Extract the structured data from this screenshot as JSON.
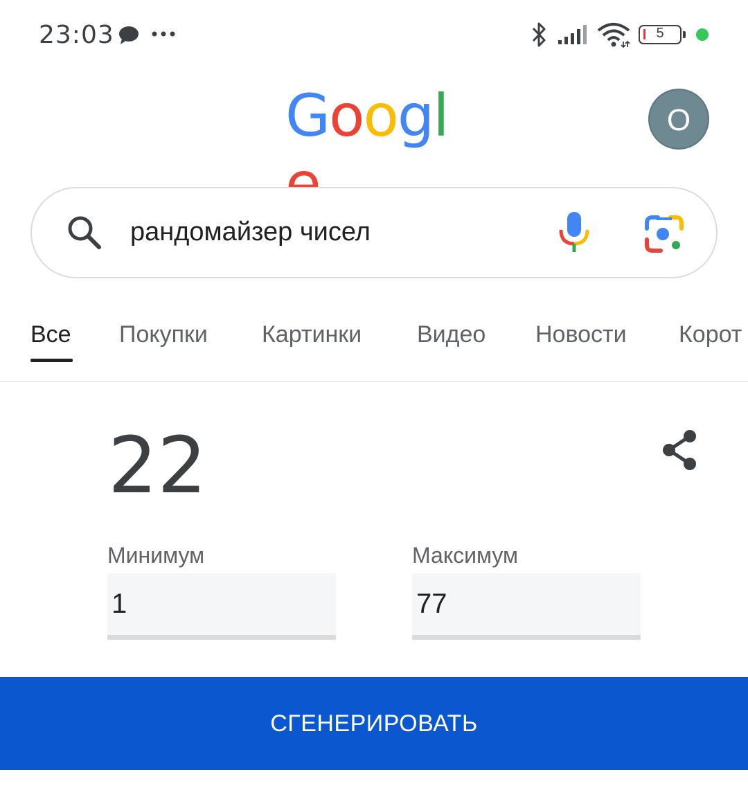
{
  "status_bar": {
    "time": "23:03",
    "battery_level": "5",
    "icons": [
      "chat-bubble-icon",
      "more-dots-icon",
      "bluetooth-icon",
      "signal-icon",
      "wifi-icon",
      "battery-icon",
      "status-dot-icon"
    ],
    "dot_color": "#34c759"
  },
  "header": {
    "logo_letters": [
      {
        "char": "G",
        "color": "#4285F4"
      },
      {
        "char": "o",
        "color": "#EA4335"
      },
      {
        "char": "o",
        "color": "#FBBC05"
      },
      {
        "char": "g",
        "color": "#4285F4"
      },
      {
        "char": "l",
        "color": "#34A853"
      },
      {
        "char": "e",
        "color": "#EA4335"
      }
    ],
    "avatar_letter": "O",
    "avatar_color": "#6f8992"
  },
  "search": {
    "query": "рандомайзер чисел"
  },
  "tabs": [
    {
      "label": "Все",
      "active": true
    },
    {
      "label": "Покупки",
      "active": false
    },
    {
      "label": "Картинки",
      "active": false
    },
    {
      "label": "Видео",
      "active": false
    },
    {
      "label": "Новости",
      "active": false
    },
    {
      "label": "Корот",
      "active": false
    }
  ],
  "widget": {
    "result": "22",
    "min_label": "Минимум",
    "min_value": "1",
    "max_label": "Максимум",
    "max_value": "77",
    "generate_label": "СГЕНЕРИРОВАТЬ",
    "button_color": "#0b57d0"
  }
}
